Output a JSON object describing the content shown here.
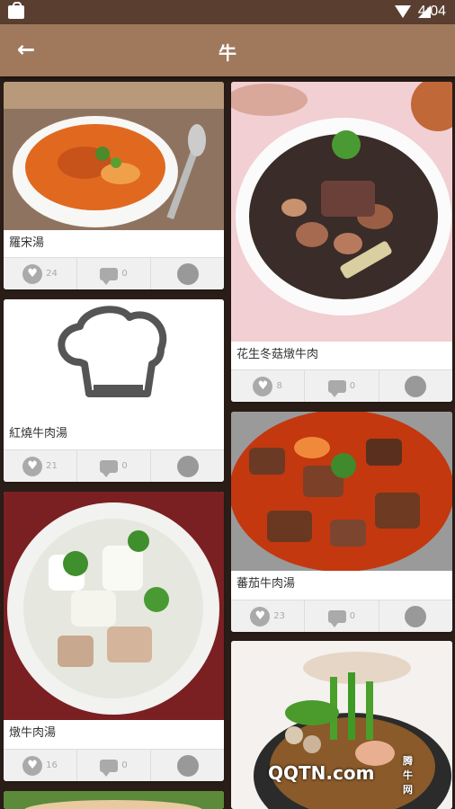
{
  "status_bar": {
    "time": "4:04"
  },
  "app_bar": {
    "title": "牛"
  },
  "cards": [
    {
      "name": "羅宋湯",
      "likes": "24",
      "comments": "0"
    },
    {
      "name": "紅燒牛肉湯",
      "likes": "21",
      "comments": "0"
    },
    {
      "name": "燉牛肉湯",
      "likes": "16",
      "comments": "0"
    },
    {
      "name": "花生冬菇燉牛肉",
      "likes": "8",
      "comments": "0"
    },
    {
      "name": "蕃茄牛肉湯",
      "likes": "23",
      "comments": "0"
    }
  ],
  "watermark": {
    "site": "QQTN.com",
    "label": "腾牛网"
  },
  "colors": {
    "appbar": "#a0795d",
    "statusbar": "#5a3f31",
    "background": "#2a1d17"
  }
}
